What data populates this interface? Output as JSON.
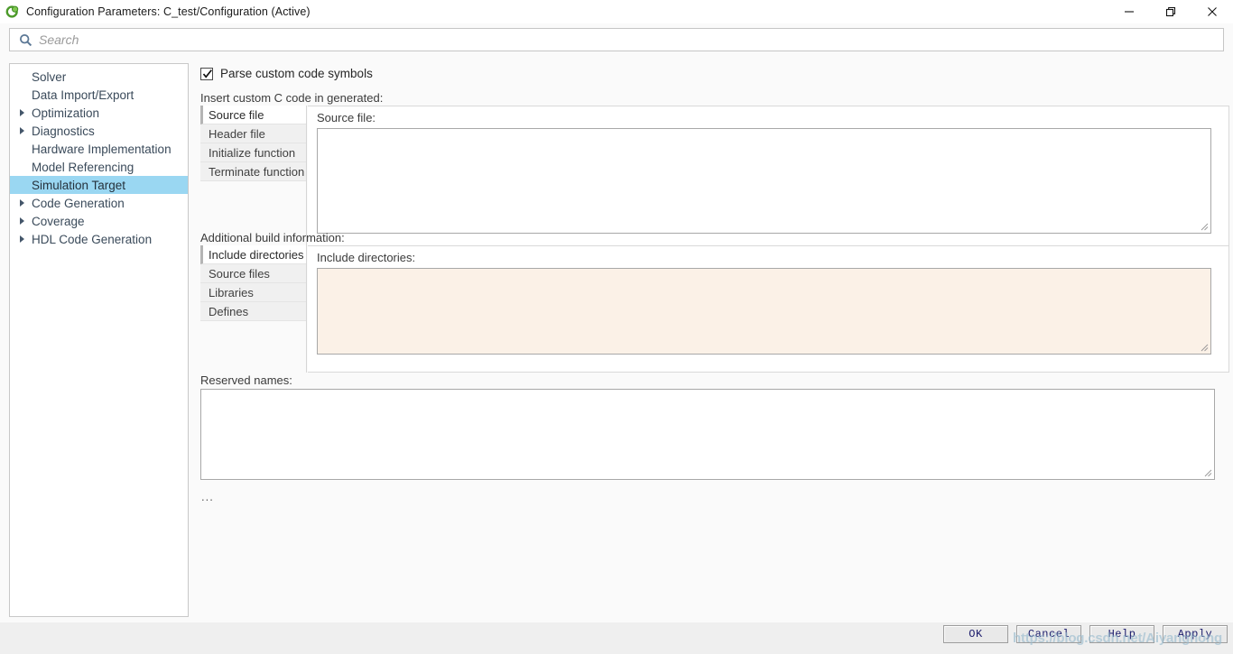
{
  "window": {
    "title": "Configuration Parameters: C_test/Configuration (Active)",
    "icon": "simulink-icon",
    "controls": {
      "minimize": "minimize-icon",
      "restore": "restore-icon",
      "close": "close-icon"
    }
  },
  "search": {
    "icon": "search-icon",
    "placeholder": "Search",
    "value": ""
  },
  "sidebar": {
    "items": [
      {
        "label": "Solver",
        "expandable": false,
        "selected": false
      },
      {
        "label": "Data Import/Export",
        "expandable": false,
        "selected": false
      },
      {
        "label": "Optimization",
        "expandable": true,
        "selected": false
      },
      {
        "label": "Diagnostics",
        "expandable": true,
        "selected": false
      },
      {
        "label": "Hardware Implementation",
        "expandable": false,
        "selected": false
      },
      {
        "label": "Model Referencing",
        "expandable": false,
        "selected": false
      },
      {
        "label": "Simulation Target",
        "expandable": false,
        "selected": true
      },
      {
        "label": "Code Generation",
        "expandable": true,
        "selected": false
      },
      {
        "label": "Coverage",
        "expandable": true,
        "selected": false
      },
      {
        "label": "HDL Code Generation",
        "expandable": true,
        "selected": false
      }
    ]
  },
  "main": {
    "parse_custom_code": {
      "label": "Parse custom code symbols",
      "checked": true
    },
    "custom_code": {
      "group_label": "Insert custom C code in generated:",
      "tabs": [
        {
          "label": "Source file",
          "active": true
        },
        {
          "label": "Header file",
          "active": false
        },
        {
          "label": "Initialize function",
          "active": false
        },
        {
          "label": "Terminate function",
          "active": false
        }
      ],
      "panel_label": "Source file:",
      "panel_value": ""
    },
    "build_info": {
      "group_label": "Additional build information:",
      "tabs": [
        {
          "label": "Include directories",
          "active": true
        },
        {
          "label": "Source files",
          "active": false
        },
        {
          "label": "Libraries",
          "active": false
        },
        {
          "label": "Defines",
          "active": false
        }
      ],
      "panel_label": "Include directories:",
      "panel_value": ""
    },
    "reserved_names": {
      "label": "Reserved names:",
      "value": ""
    },
    "more_indicator": "..."
  },
  "footer": {
    "buttons": [
      {
        "label": "OK",
        "name": "ok-button"
      },
      {
        "label": "Cancel",
        "name": "cancel-button"
      },
      {
        "label": "Help",
        "name": "help-button"
      },
      {
        "label": "Apply",
        "name": "apply-button"
      }
    ]
  },
  "watermark": {
    "text": "https://blog.csdn.net/Aiyanghong"
  },
  "colors": {
    "selection": "#9ad7f2",
    "highlight_field": "#fbf1e7",
    "button_text": "#1b1b6b",
    "accent_icon": "#4c9a2a"
  }
}
